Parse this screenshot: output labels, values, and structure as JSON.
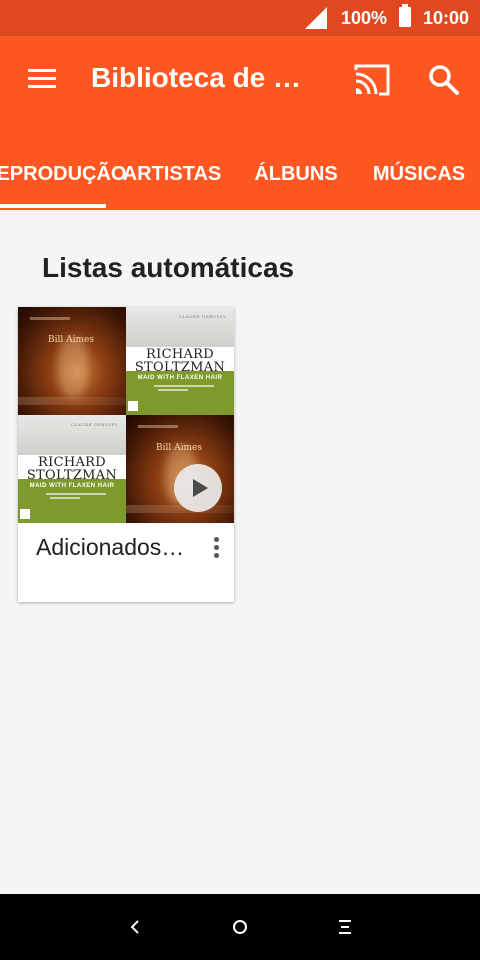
{
  "status_bar": {
    "battery": "100%",
    "time": "10:00"
  },
  "app_bar": {
    "title": "Biblioteca de m…",
    "tabs": [
      {
        "label": "REPRODUÇÃO",
        "active": true
      },
      {
        "label": "ARTISTAS",
        "active": false
      },
      {
        "label": "ÁLBUNS",
        "active": false
      },
      {
        "label": "MÚSICAS",
        "active": false
      }
    ]
  },
  "main": {
    "section_title": "Listas automáticas",
    "cards": [
      {
        "title": "Adicionados…"
      }
    ],
    "album_art": {
      "artist_first": "RICHARD",
      "artist_last": "STOLTZMAN",
      "album": "MAID WITH FLAXEN HAIR",
      "composer": "CLAUDE DEBUSSY",
      "piano_text": "Bill Aimes"
    }
  },
  "colors": {
    "status_bar": "#e0491f",
    "app_bar": "#ff5722",
    "background": "#f5f5f5",
    "nav_bar": "#000000"
  },
  "icons": {
    "menu": "menu-icon",
    "cast": "cast-icon",
    "search": "search-icon",
    "play": "play-icon",
    "more": "more-vert-icon",
    "back": "back-icon",
    "home": "home-icon",
    "recents": "recents-icon"
  }
}
